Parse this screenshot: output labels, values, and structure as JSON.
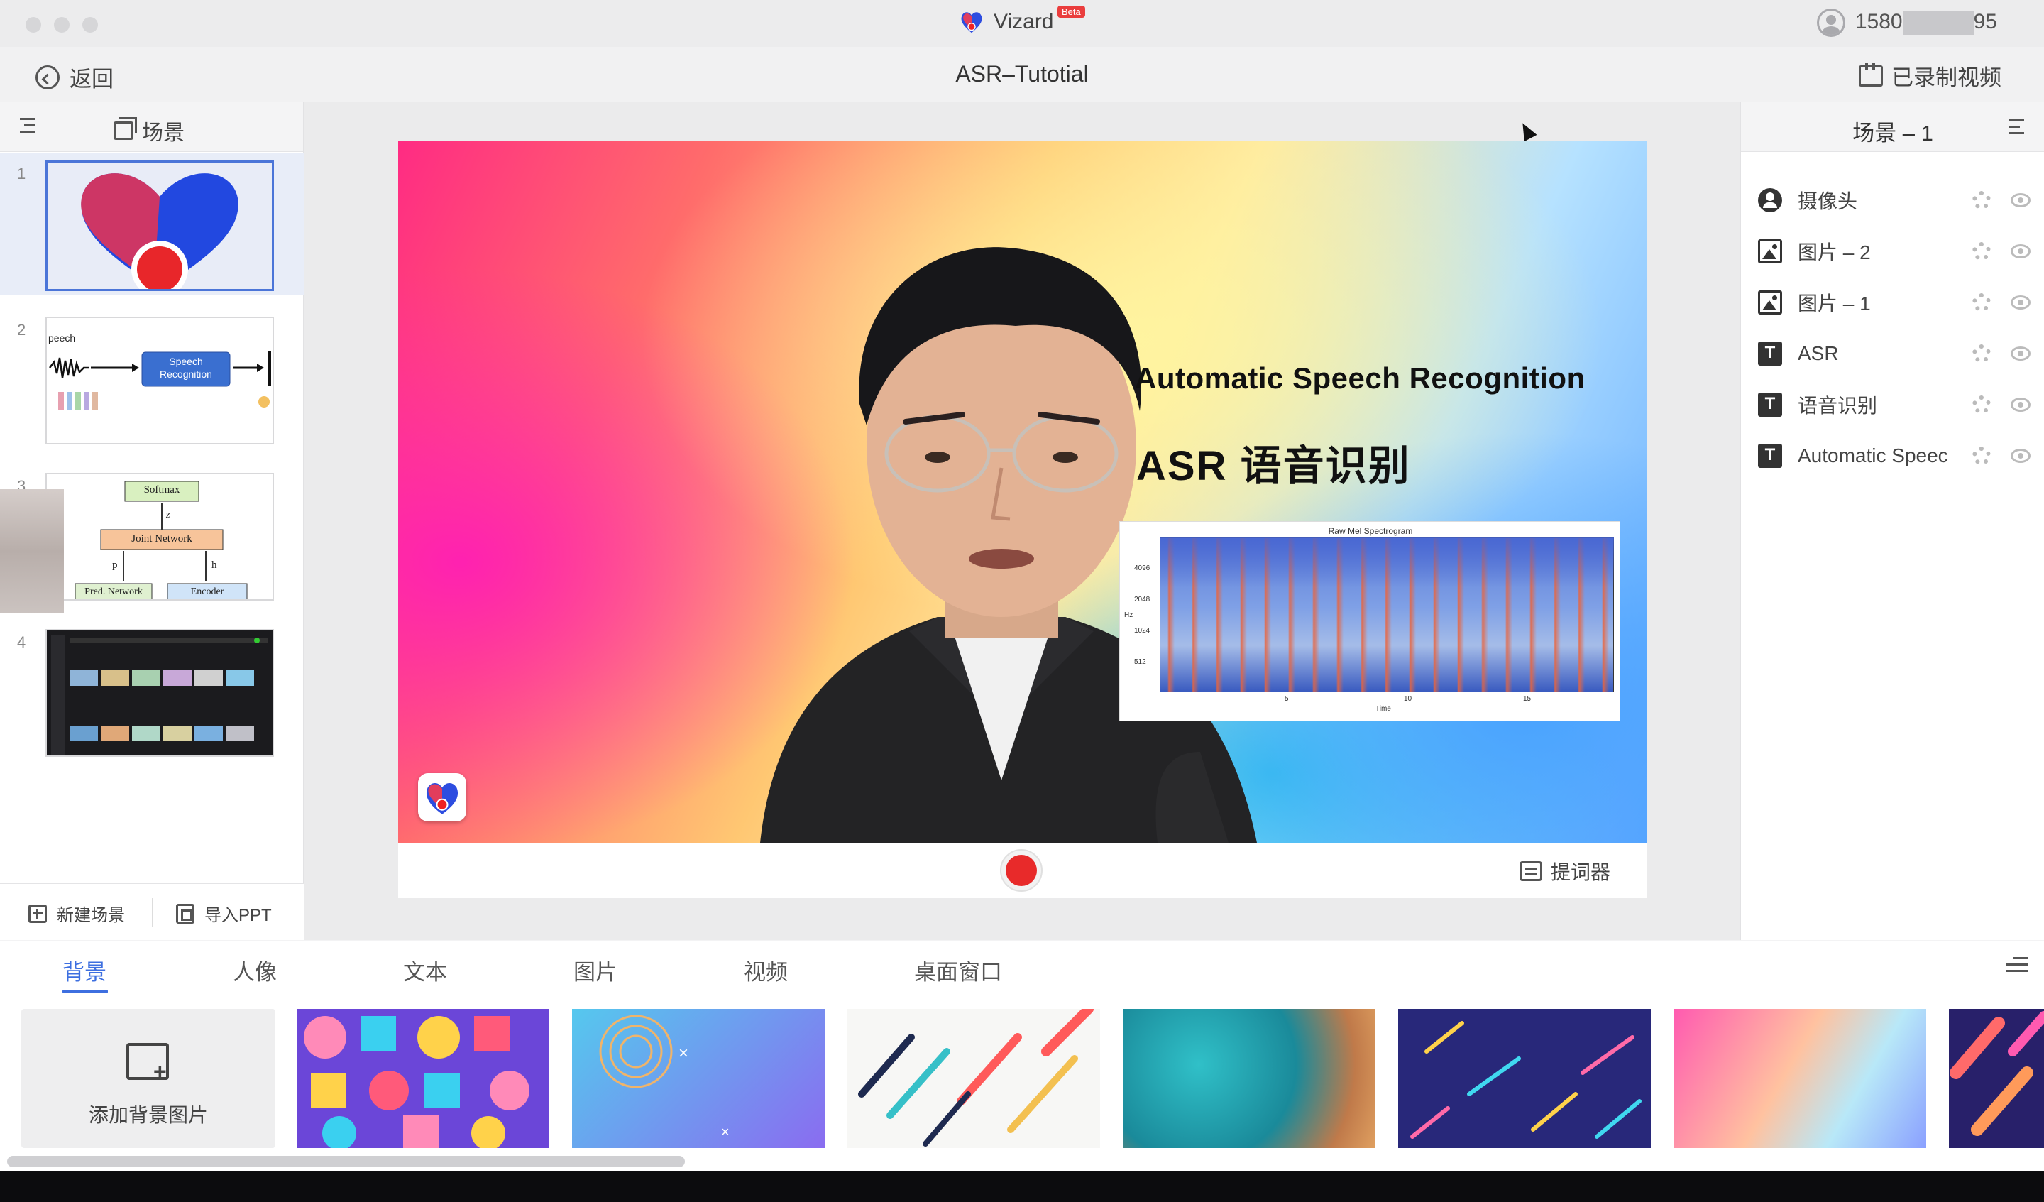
{
  "titlebar": {
    "app_name": "Vizard",
    "beta_badge": "Beta",
    "user_phone_prefix": "1580",
    "user_phone_suffix": "95"
  },
  "header": {
    "back_label": "返回",
    "project_title": "ASR–Tutotial",
    "recorded_label": "已录制视频"
  },
  "left_panel": {
    "tab_label": "场景",
    "slides": [
      {
        "number": "1"
      },
      {
        "number": "2",
        "thumb_text_top": "peech",
        "thumb_box": "Speech Recognition"
      },
      {
        "number": "3",
        "thumb_softmax": "Softmax",
        "thumb_z": "z",
        "thumb_joint": "Joint Network",
        "thumb_p": "p",
        "thumb_h": "h",
        "thumb_pred": "Pred. Network",
        "thumb_encoder": "Encoder"
      },
      {
        "number": "4"
      }
    ],
    "new_scene_label": "新建场景",
    "import_ppt_label": "导入PPT"
  },
  "preview": {
    "title": "Automatic Speech Recognition",
    "subtitle": "ASR   语音识别",
    "spectrogram_title": "Raw Mel Spectrogram",
    "spectrogram_yticks": [
      "4096",
      "2048",
      "1024",
      "512"
    ],
    "spectrogram_ylabel": "Hz",
    "spectrogram_xticks": [
      "5",
      "10",
      "15"
    ],
    "spectrogram_xlabel": "Time",
    "prompter_label": "提词器"
  },
  "right_panel": {
    "scene_name": "场景 – 1",
    "layers": [
      {
        "label": "摄像头",
        "icon": "camera-icon"
      },
      {
        "label": "图片 – 2",
        "icon": "image-icon"
      },
      {
        "label": "图片 – 1",
        "icon": "image-icon"
      },
      {
        "label": "ASR",
        "icon": "text-icon"
      },
      {
        "label": "语音识别",
        "icon": "text-icon"
      },
      {
        "label": "Automatic Speec",
        "icon": "text-icon"
      }
    ]
  },
  "bottom": {
    "tabs": [
      "背景",
      "人像",
      "文本",
      "图片",
      "视频",
      "桌面窗口"
    ],
    "active_tab": "背景",
    "add_background_label": "添加背景图片"
  },
  "colors": {
    "accent": "#3d6fe0",
    "record": "#e82a2a",
    "brand_red": "#ea3d3d"
  }
}
